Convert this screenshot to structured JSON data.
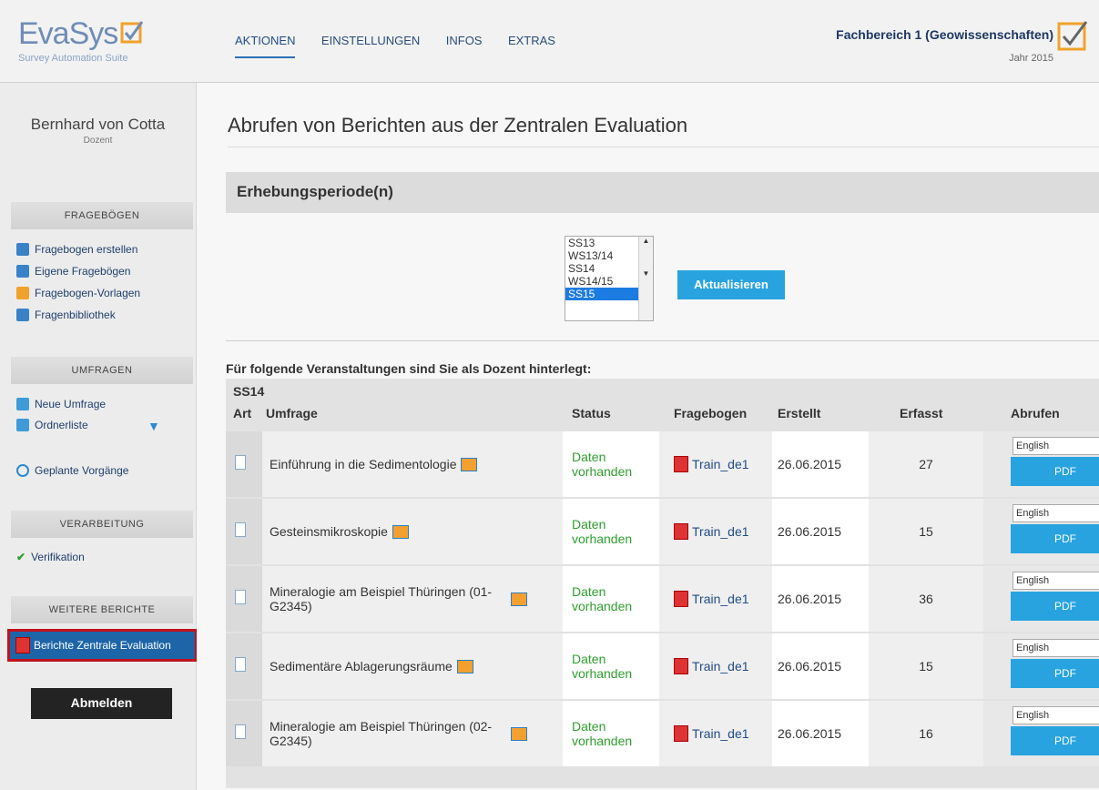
{
  "header": {
    "logo_name": "EvaSys",
    "logo_sub": "Survey Automation Suite",
    "nav": [
      "AKTIONEN",
      "EINSTELLUNGEN",
      "INFOS",
      "EXTRAS"
    ],
    "org_title": "Fachbereich 1 (Geowissenschaften)",
    "org_year": "Jahr 2015"
  },
  "sidebar": {
    "user_name": "Bernhard von Cotta",
    "user_role": "Dozent",
    "sec_fragebogen": "FRAGEBÖGEN",
    "fragebogen_items": [
      "Fragebogen erstellen",
      "Eigene Fragebögen",
      "Fragebogen-Vorlagen",
      "Fragenbibliothek"
    ],
    "sec_umfragen": "UMFRAGEN",
    "umfragen_items": [
      "Neue Umfrage",
      "Ordnerliste",
      "Geplante Vorgänge"
    ],
    "sec_verarbeitung": "VERARBEITUNG",
    "verarbeitung_items": [
      "Verifikation"
    ],
    "sec_weitere": "WEITERE BERICHTE",
    "active_item": "Berichte Zentrale Evaluation",
    "logout": "Abmelden"
  },
  "main": {
    "title": "Abrufen von Berichten aus der Zentralen Evaluation",
    "period_label": "Erhebungsperiode(n)",
    "periods": [
      "SS13",
      "WS13/14",
      "SS14",
      "WS14/15",
      "SS15"
    ],
    "selected_period": "SS15",
    "refresh": "Aktualisieren",
    "intro": "Für folgende Veranstaltungen sind Sie als Dozent hinterlegt:",
    "semester": "SS14",
    "columns": [
      "Art",
      "Umfrage",
      "Status",
      "Fragebogen",
      "Erstellt",
      "Erfasst",
      "Abrufen"
    ],
    "rows": [
      {
        "umfrage": "Einführung in die Sedimentologie",
        "status": "Daten vorhanden",
        "fragebogen": "Train_de1",
        "erstellt": "26.06.2015",
        "erfasst": "27",
        "lang": "English",
        "btn": "PDF"
      },
      {
        "umfrage": "Gesteinsmikroskopie",
        "status": "Daten vorhanden",
        "fragebogen": "Train_de1",
        "erstellt": "26.06.2015",
        "erfasst": "15",
        "lang": "English",
        "btn": "PDF"
      },
      {
        "umfrage": "Mineralogie am Beispiel Thüringen (01-G2345)",
        "status": "Daten vorhanden",
        "fragebogen": "Train_de1",
        "erstellt": "26.06.2015",
        "erfasst": "36",
        "lang": "English",
        "btn": "PDF"
      },
      {
        "umfrage": "Sedimentäre Ablagerungsräume",
        "status": "Daten vorhanden",
        "fragebogen": "Train_de1",
        "erstellt": "26.06.2015",
        "erfasst": "15",
        "lang": "English",
        "btn": "PDF"
      },
      {
        "umfrage": "Mineralogie am Beispiel Thüringen (02-G2345)",
        "status": "Daten vorhanden",
        "fragebogen": "Train_de1",
        "erstellt": "26.06.2015",
        "erfasst": "16",
        "lang": "English",
        "btn": "PDF"
      }
    ]
  },
  "colors": {
    "accent": "#28a3df",
    "nav": "#2a4c7a",
    "active_item_bg": "#1e65a8",
    "highlight_border": "#c1121c",
    "status": "#2f9e2f"
  }
}
